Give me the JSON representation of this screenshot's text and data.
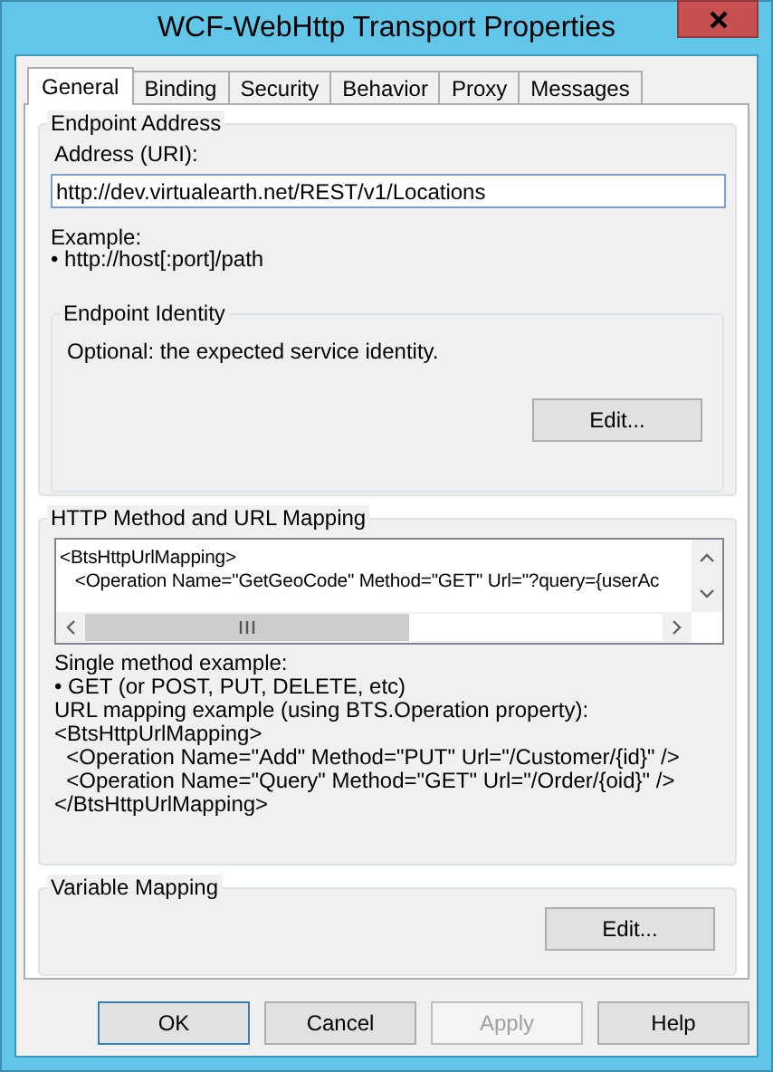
{
  "window": {
    "title": "WCF-WebHttp Transport Properties"
  },
  "tabs": [
    {
      "label": "General",
      "selected": true
    },
    {
      "label": "Binding",
      "selected": false
    },
    {
      "label": "Security",
      "selected": false
    },
    {
      "label": "Behavior",
      "selected": false
    },
    {
      "label": "Proxy",
      "selected": false
    },
    {
      "label": "Messages",
      "selected": false
    }
  ],
  "endpoint_address": {
    "title": "Endpoint Address",
    "address_label": "Address (URI):",
    "address_value": "http://dev.virtualearth.net/REST/v1/Locations",
    "example_label": "Example:",
    "example_value": "• http://host[:port]/path",
    "endpoint_identity": {
      "title": "Endpoint Identity",
      "description": "Optional: the expected service identity.",
      "button": "Edit..."
    }
  },
  "http_mapping": {
    "title": "HTTP Method and URL Mapping",
    "editor_lines": [
      "<BtsHttpUrlMapping>",
      "   <Operation Name=\"GetGeoCode\" Method=\"GET\" Url=\"?query={userAc"
    ],
    "notes": [
      "Single method example:",
      "• GET (or POST, PUT, DELETE, etc)",
      "URL mapping example (using BTS.Operation property):",
      "<BtsHttpUrlMapping>",
      "  <Operation Name=\"Add\" Method=\"PUT\" Url=\"/Customer/{id}\" />",
      "  <Operation Name=\"Query\" Method=\"GET\" Url=\"/Order/{oid}\" />",
      "</BtsHttpUrlMapping>"
    ]
  },
  "variable_mapping": {
    "title": "Variable Mapping",
    "button": "Edit..."
  },
  "buttons": [
    {
      "label": "OK",
      "disabled": false,
      "default": true
    },
    {
      "label": "Cancel",
      "disabled": false,
      "default": false
    },
    {
      "label": "Apply",
      "disabled": true,
      "default": false
    },
    {
      "label": "Help",
      "disabled": false,
      "default": false
    }
  ]
}
